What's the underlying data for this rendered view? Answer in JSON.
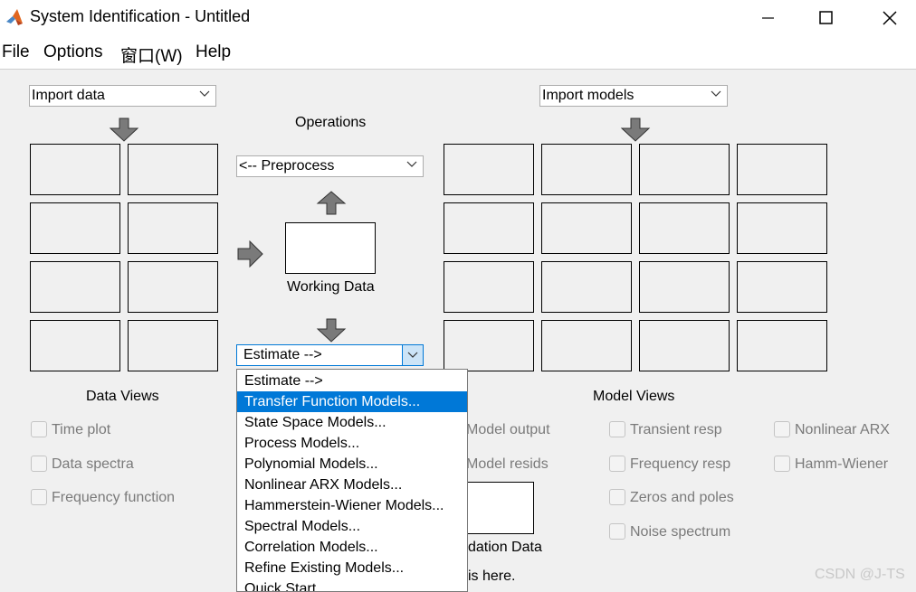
{
  "window": {
    "title": "System Identification - Untitled",
    "controls": [
      "minimize-icon",
      "maximize-icon",
      "close-icon"
    ]
  },
  "menubar": {
    "items": [
      "File",
      "Options",
      "窗口(W)",
      "Help"
    ]
  },
  "data_panel": {
    "import_data": "Import data",
    "title": "Data Views",
    "views": [
      "Time plot",
      "Data spectra",
      "Frequency function"
    ]
  },
  "operations": {
    "title": "Operations",
    "preprocess": "<-- Preprocess",
    "working_data": "Working Data",
    "estimate": "Estimate -->"
  },
  "models_panel": {
    "import_models": "Import models",
    "title": "Model Views",
    "views_col1": [
      "Model output",
      "Model resids"
    ],
    "views_col2": [
      "Transient resp",
      "Frequency resp",
      "Zeros and poles",
      "Noise spectrum"
    ],
    "views_col3": [
      "Nonlinear ARX",
      "Hamm-Wiener"
    ],
    "validation_label_partial": "dation Data",
    "hint_partial": "is here."
  },
  "estimate_dropdown": {
    "selected_index": 1,
    "items": [
      "Estimate -->",
      "Transfer Function Models...",
      "State Space Models...",
      "Process Models...",
      "Polynomial Models...",
      "Nonlinear ARX Models...",
      "Hammerstein-Wiener Models...",
      "Spectral Models...",
      "Correlation Models...",
      "Refine Existing Models...",
      "Quick Start"
    ]
  },
  "watermark": "CSDN @J-TS",
  "colors": {
    "selection": "#0078d7",
    "background": "#f0f0f0"
  }
}
